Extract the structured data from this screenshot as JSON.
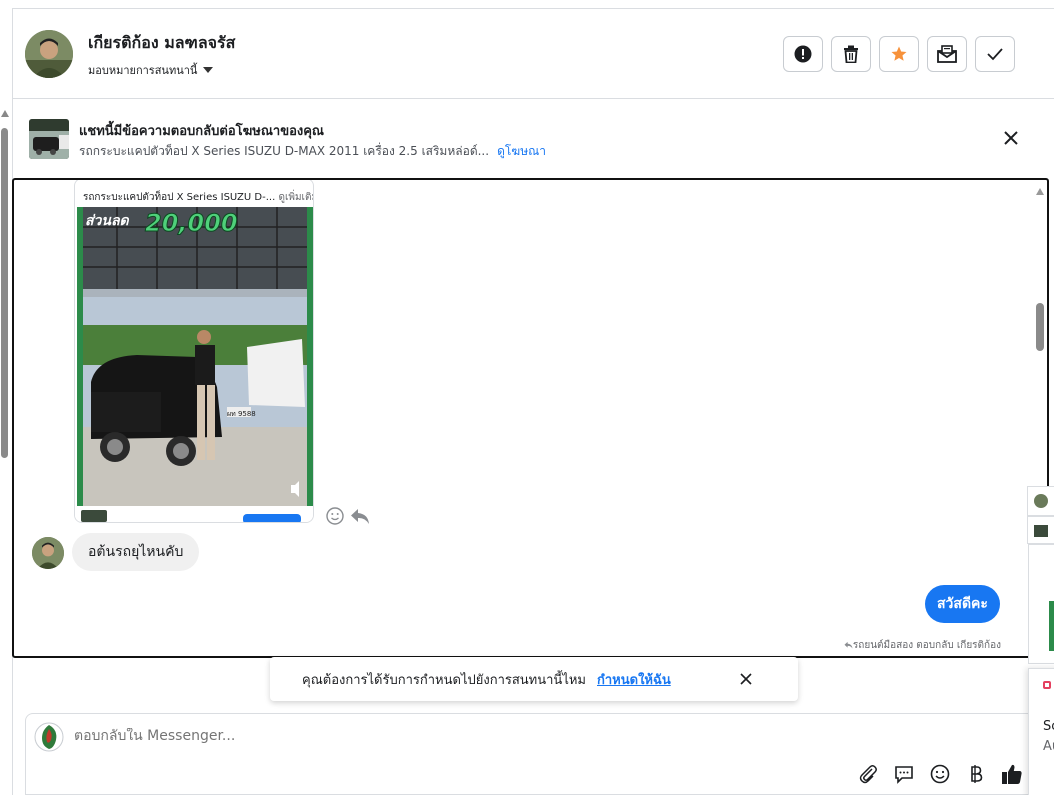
{
  "header": {
    "contact_name": "เกียรติก้อง มลฑลจรัส",
    "assign_label": "มอบหมายการสนทนานี้",
    "actions": [
      {
        "name": "report-icon"
      },
      {
        "name": "trash-icon"
      },
      {
        "name": "star-icon",
        "color": "#f7923b"
      },
      {
        "name": "mark-unread-icon"
      },
      {
        "name": "done-check-icon"
      }
    ]
  },
  "ad_banner": {
    "title": "แชทนี้มีข้อความตอบกลับต่อโฆษณาของคุณ",
    "subtitle": "รถกระบะแคปตัวท็อป X Series ISUZU D-MAX 2011 เครื่อง 2.5 เสริมหล่อด์...",
    "link": "ดูโฆษณา"
  },
  "conversation": {
    "ad_card": {
      "caption": "รถกระบะแคปตัวท็อป X Series ISUZU D-...",
      "more": "ดูเพิ่มเติม",
      "discount_label": "ส่วนลด",
      "discount_value": "20,000",
      "plate": "ผท 9588"
    },
    "incoming_message": "อต้นรถยุไหนคับ",
    "outgoing_message": "สวัสดีคะ",
    "attribution": "รถยนต์มือสอง ตอบกลับ เกียรติก้อง"
  },
  "assign_prompt": {
    "text": "คุณต้องการได้รับการกำหนดไปยังการสนทนานี้ไหม",
    "link": "กำหนดให้ฉัน"
  },
  "composer": {
    "placeholder": "ตอบกลับใน Messenger...",
    "tools": [
      "paperclip-icon",
      "saved-reply-icon",
      "emoji-icon",
      "baht-payment-icon",
      "thumbs-up-icon"
    ]
  },
  "right_edge": {
    "fragment_1": "Sc",
    "fragment_2": "Au"
  },
  "colors": {
    "accent": "#1877f2",
    "star": "#f7923b",
    "bubble_in": "#f0f0f0"
  }
}
